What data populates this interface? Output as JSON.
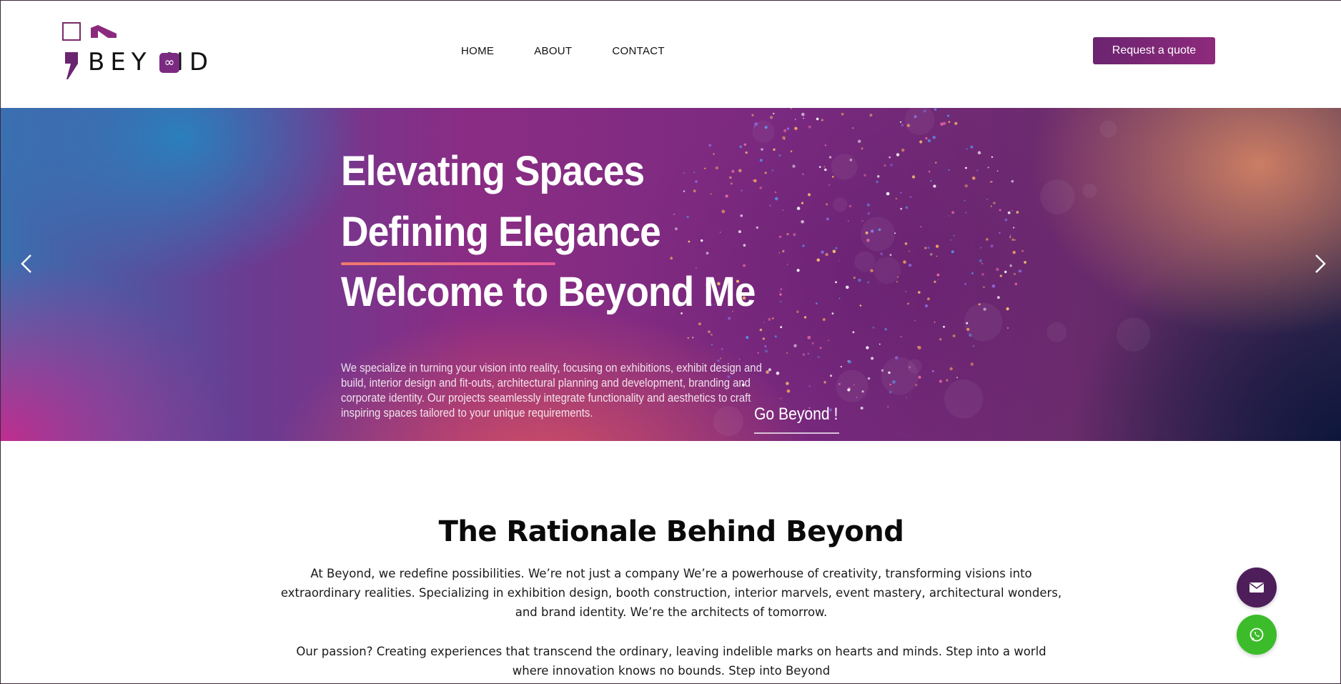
{
  "brand": {
    "name": "BEY  ND",
    "infinity_glyph": "∞",
    "accent": "#7b2a82"
  },
  "nav": {
    "items": [
      {
        "label": "HOME"
      },
      {
        "label": "ABOUT"
      },
      {
        "label": "CONTACT"
      }
    ]
  },
  "header": {
    "quote_label": "Request a quote"
  },
  "hero": {
    "line1": "Elevating Spaces",
    "line2": "Defining Elegance",
    "line3": "Welcome to Beyond Me",
    "description": "We specialize in turning your vision into reality, focusing on exhibitions, exhibit design and build, interior design and fit-outs, architectural planning and development, branding and corporate identity. Our projects seamlessly integrate functionality and aesthetics to craft inspiring spaces tailored to your unique requirements.",
    "cta": "Go Beyond !",
    "prev_icon": "chevron-left-icon",
    "next_icon": "chevron-right-icon"
  },
  "rationale": {
    "title": "The Rationale Behind Beyond",
    "paragraph1": "At Beyond, we redefine possibilities. We’re not just a company We’re a powerhouse of creativity, transforming visions into extraordinary realities. Specializing in exhibition design, booth construction, interior marvels, event mastery, architectural wonders, and brand identity. We’re the architects of tomorrow.",
    "paragraph2": "Our passion? Creating experiences that transcend the ordinary, leaving indelible marks on hearts and minds. Step into a world where innovation knows no bounds. Step into Beyond"
  },
  "floating": {
    "mail_icon": "mail-icon",
    "whatsapp_icon": "whatsapp-icon",
    "mail_color": "#4e1e5a",
    "whatsapp_color": "#3cbc2a"
  }
}
